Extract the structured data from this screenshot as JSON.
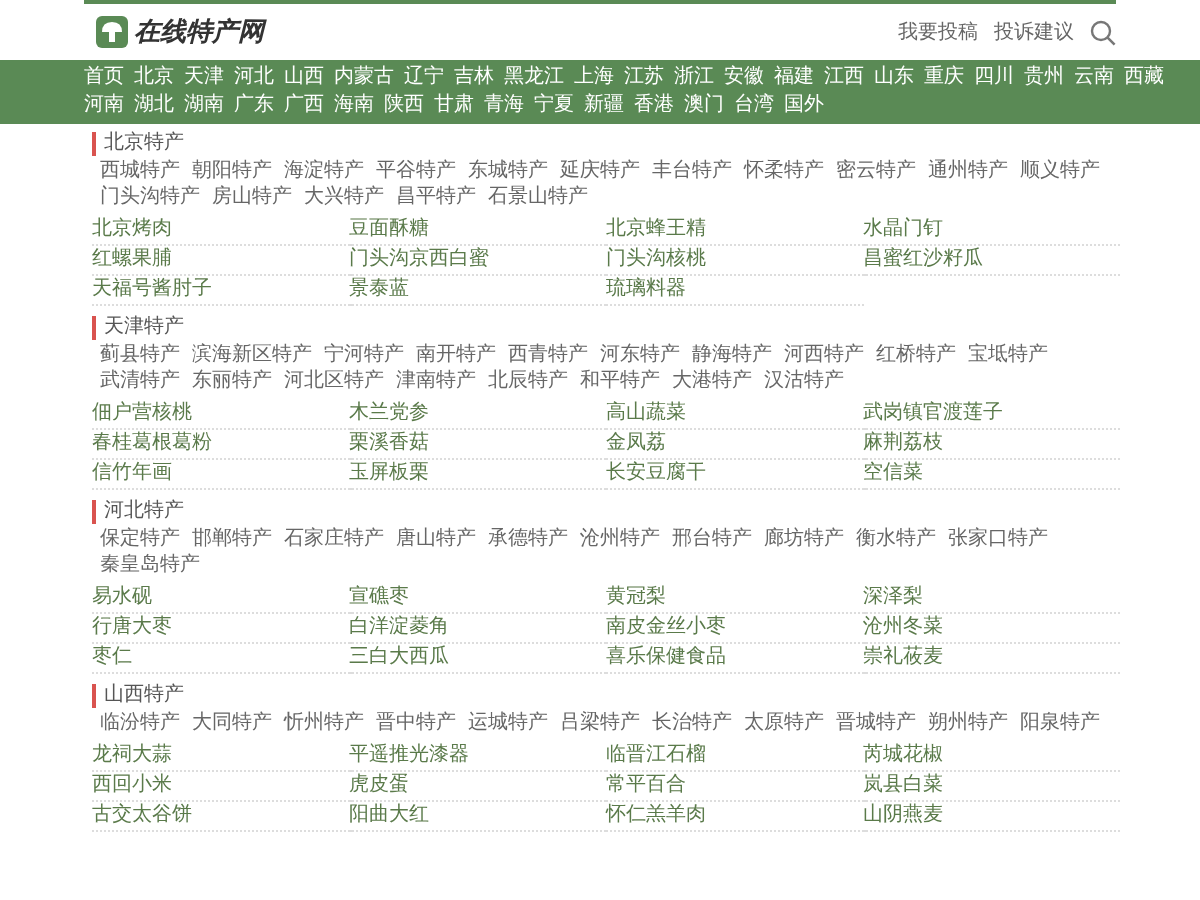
{
  "header": {
    "logo": "在线特产网",
    "links": [
      "我要投稿",
      "投诉建议"
    ]
  },
  "nav": [
    "首页",
    "北京",
    "天津",
    "河北",
    "山西",
    "内蒙古",
    "辽宁",
    "吉林",
    "黑龙江",
    "上海",
    "江苏",
    "浙江",
    "安徽",
    "福建",
    "江西",
    "山东",
    "重庆",
    "四川",
    "贵州",
    "云南",
    "西藏",
    "河南",
    "湖北",
    "湖南",
    "广东",
    "广西",
    "海南",
    "陕西",
    "甘肃",
    "青海",
    "宁夏",
    "新疆",
    "香港",
    "澳门",
    "台湾",
    "国外"
  ],
  "sections": [
    {
      "title": "北京特产",
      "areas": [
        "西城特产",
        "朝阳特产",
        "海淀特产",
        "平谷特产",
        "东城特产",
        "延庆特产",
        "丰台特产",
        "怀柔特产",
        "密云特产",
        "通州特产",
        "顺义特产",
        "门头沟特产",
        "房山特产",
        "大兴特产",
        "昌平特产",
        "石景山特产"
      ],
      "products": [
        "北京烤肉",
        "豆面酥糖",
        "北京蜂王精",
        "水晶门钉",
        "红螺果脯",
        "门头沟京西白蜜",
        "门头沟核桃",
        "昌蜜红沙籽瓜",
        "天福号酱肘子",
        "景泰蓝",
        "琉璃料器"
      ]
    },
    {
      "title": "天津特产",
      "areas": [
        "蓟县特产",
        "滨海新区特产",
        "宁河特产",
        "南开特产",
        "西青特产",
        "河东特产",
        "静海特产",
        "河西特产",
        "红桥特产",
        "宝坻特产",
        "武清特产",
        "东丽特产",
        "河北区特产",
        "津南特产",
        "北辰特产",
        "和平特产",
        "大港特产",
        "汉沽特产"
      ],
      "products": [
        "佃户营核桃",
        "木兰党参",
        "高山蔬菜",
        "武岗镇官渡莲子",
        "春桂葛根葛粉",
        "栗溪香菇",
        "金凤荔",
        "麻荆荔枝",
        "信竹年画",
        "玉屏板栗",
        "长安豆腐干",
        "空信菜"
      ]
    },
    {
      "title": "河北特产",
      "areas": [
        "保定特产",
        "邯郸特产",
        "石家庄特产",
        "唐山特产",
        "承德特产",
        "沧州特产",
        "邢台特产",
        "廊坊特产",
        "衡水特产",
        "张家口特产",
        "秦皇岛特产"
      ],
      "products": [
        "易水砚",
        "宣礁枣",
        "黄冠梨",
        "深泽梨",
        "行唐大枣",
        "白洋淀菱角",
        "南皮金丝小枣",
        "沧州冬菜",
        "枣仁",
        "三白大西瓜",
        "喜乐保健食品",
        "崇礼莜麦"
      ]
    },
    {
      "title": "山西特产",
      "areas": [
        "临汾特产",
        "大同特产",
        "忻州特产",
        "晋中特产",
        "运城特产",
        "吕梁特产",
        "长治特产",
        "太原特产",
        "晋城特产",
        "朔州特产",
        "阳泉特产"
      ],
      "products": [
        "龙祠大蒜",
        "平遥推光漆器",
        "临晋江石榴",
        "芮城花椒",
        "西回小米",
        "虎皮蛋",
        "常平百合",
        "岚县白菜",
        "古交太谷饼",
        "阳曲大红",
        "怀仁羔羊肉",
        "山阴燕麦"
      ]
    }
  ]
}
